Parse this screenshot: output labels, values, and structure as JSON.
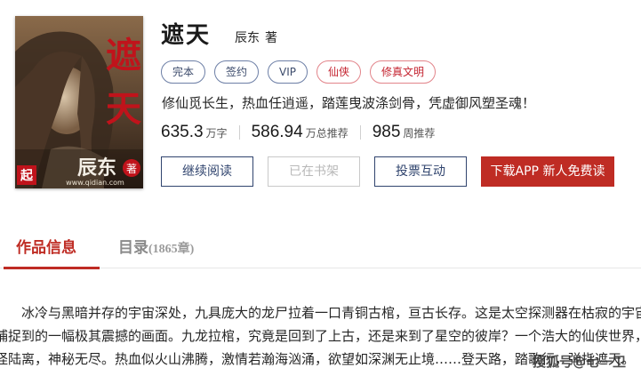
{
  "book": {
    "title": "遮天",
    "author": "辰东",
    "author_suffix": "著",
    "tags": [
      "完本",
      "签约",
      "VIP",
      "仙侠",
      "修真文明"
    ],
    "intro": "修仙觅长生，热血任逍遥，踏莲曳波涤剑骨，凭虚御风塑圣魂！"
  },
  "cover": {
    "title_chars": [
      "遮",
      "天"
    ],
    "author": "辰东",
    "mark": "著",
    "badge": "起",
    "url": "www.qidian.com"
  },
  "stats": [
    {
      "value": "635.3",
      "unit": "万字"
    },
    {
      "value": "586.94",
      "unit": "万总推荐"
    },
    {
      "value": "985",
      "unit": "周推荐"
    }
  ],
  "buttons": {
    "continue": "继续阅读",
    "shelf": "已在书架",
    "vote": "投票互动",
    "download": "下载APP 新人免费读"
  },
  "tabs": {
    "info": "作品信息",
    "catalog": "目录",
    "catalog_count": "(1865章)"
  },
  "description": [
    "　　冰冷与黑暗并存的宇宙深处，九具庞大的龙尸拉着一口青铜古棺，亘古长存。这是太空探测器在枯寂的宇宙中",
    "捕捉到的一幅极其震撼的画面。九龙拉棺，究竟是回到了上古，还是来到了星空的彼岸？一个浩大的仙侠世界，光",
    "怪陆离，神秘无尽。热血似火山沸腾，激情若瀚海汹涌，欲望如深渊无止境……登天路，踏歌行，弹指遮天。"
  ],
  "watermark": "搜狐号@七一卫",
  "colors": {
    "accent_red": "#bf2c24",
    "navy": "#30446e",
    "tag_border": "#6d7fa6"
  }
}
